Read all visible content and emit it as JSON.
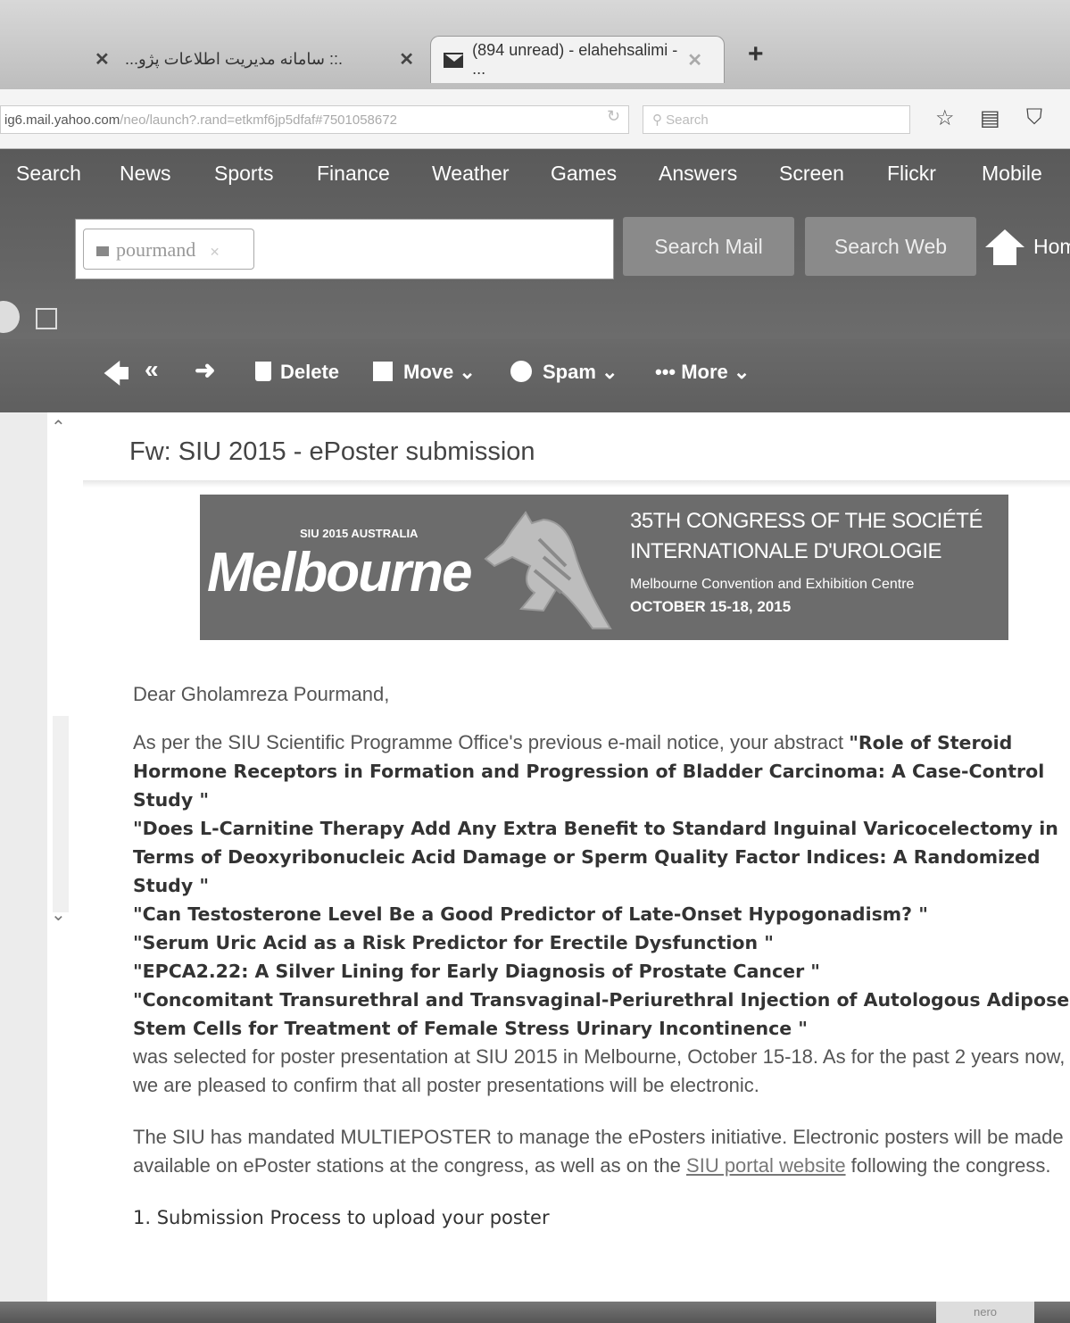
{
  "browser": {
    "tabs": [
      {
        "label": ""
      },
      {
        "label": "...سامانه مدیریت اطلاعات پژو ::."
      },
      {
        "label": "(894 unread) - elahehsalimi - ..."
      }
    ],
    "close_glyph": "✕",
    "new_tab_glyph": "+",
    "url_host": "ig6.mail.yahoo.com",
    "url_rest": "/neo/launch?.rand=etkmf6jp5dfaf#7501058672",
    "search_placeholder": "Search",
    "icons": [
      "reload-icon",
      "star-icon",
      "clipboard-icon",
      "pocket-icon"
    ]
  },
  "yahoo": {
    "nav": [
      "Search",
      "News",
      "Sports",
      "Finance",
      "Weather",
      "Games",
      "Answers",
      "Screen",
      "Flickr",
      "Mobile"
    ],
    "search_chip": "pourmand",
    "search_mail": "Search Mail",
    "search_web": "Search Web",
    "home": "Hom"
  },
  "toolbar": {
    "delete": "Delete",
    "move": "Move ⌄",
    "spam": "Spam ⌄",
    "more": "More ⌄"
  },
  "message": {
    "subject": "Fw: SIU 2015 - ePoster submission",
    "banner": {
      "small": "SIU 2015 AUSTRALIA",
      "city": "Melbourne",
      "line1": "35TH CONGRESS OF THE SOCIÉTÉ",
      "line2": "INTERNATIONALE D'UROLOGIE",
      "line3": "Melbourne Convention and Exhibition Centre",
      "line4": "OCTOBER 15-18, 2015"
    },
    "greeting": "Dear Gholamreza Pourmand,",
    "intro": "As per the SIU Scientific Programme Office's previous e-mail notice, your abstract ",
    "titles": [
      "\"Role of Steroid Hormone Receptors in Formation and Progression of Bladder Carcinoma: A Case-Control Study \"",
      "\"Does L-Carnitine Therapy Add Any Extra Benefit to Standard Inguinal Varicocelectomy in Terms of Deoxyribonucleic Acid Damage or Sperm Quality Factor Indices: A Randomized Study \"",
      "\"Can Testosterone Level Be a Good Predictor of Late-Onset Hypogonadism? \"",
      "\"Serum Uric Acid as a Risk Predictor for Erectile Dysfunction \"",
      "\"EPCA2.22: A Silver Lining for Early Diagnosis of Prostate Cancer \"",
      "\"Concomitant Transurethral and Transvaginal-Periurethral Injection of Autologous Adipose Stem Cells for Treatment of Female Stress Urinary Incontinence \""
    ],
    "selected": "was selected for poster presentation at SIU 2015 in Melbourne, October 15-18. As for the past 2 years now, we are pleased to confirm that all poster presentations will be electronic.",
    "mandate_a": "The SIU has mandated MULTIEPOSTER to manage the ePosters initiative. Electronic posters will be made available on ePoster stations at the congress, as well as on the ",
    "link": "SIU portal website",
    "mandate_b": " following the congress.",
    "section1": "1. Submission Process to upload your poster"
  },
  "taskbar": {
    "nero": "nero"
  }
}
